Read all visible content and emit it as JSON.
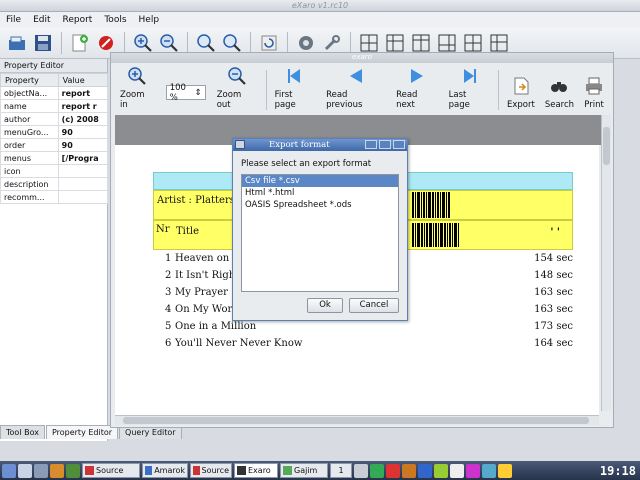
{
  "window": {
    "title": "eXaro v1.rc10"
  },
  "menu": [
    "File",
    "Edit",
    "Report",
    "Tools",
    "Help"
  ],
  "property_editor": {
    "title": "Property Editor",
    "columns": [
      "Property",
      "Value"
    ],
    "rows": [
      {
        "prop": "objectNa...",
        "value": "report"
      },
      {
        "prop": "name",
        "value": "report r"
      },
      {
        "prop": "author",
        "value": "(c) 2008"
      },
      {
        "prop": "menuGro...",
        "value": "90"
      },
      {
        "prop": "order",
        "value": "90"
      },
      {
        "prop": "menus",
        "value": "[/Progra"
      },
      {
        "prop": "icon",
        "value": ""
      },
      {
        "prop": "description",
        "value": ""
      },
      {
        "prop": "recomm...",
        "value": ""
      }
    ],
    "tabs": [
      "Tool Box",
      "Property Editor",
      "Query Editor"
    ]
  },
  "viewer": {
    "title": "exaro",
    "zoom_value": "100 %",
    "buttons": {
      "zoom_in": "Zoom in",
      "zoom_out": "Zoom out",
      "first_page": "First page",
      "read_previous": "Read previous",
      "read_next": "Read next",
      "last_page": "Last page",
      "export": "Export",
      "search": "Search",
      "print": "Print"
    }
  },
  "report": {
    "artist_label": "Artist : Platters",
    "header_nr": "Nr",
    "header_title": "Title",
    "header_dots": "' '",
    "songs": [
      {
        "n": "1",
        "title": "Heaven on E",
        "dur": "154 sec"
      },
      {
        "n": "2",
        "title": "It Isn't Righ",
        "dur": "148 sec"
      },
      {
        "n": "3",
        "title": "My Prayer",
        "dur": "163 sec"
      },
      {
        "n": "4",
        "title": "On My Word",
        "dur": "163 sec"
      },
      {
        "n": "5",
        "title": "One in a Million",
        "dur": "173 sec"
      },
      {
        "n": "6",
        "title": "You'll Never Never Know",
        "dur": "164 sec"
      }
    ]
  },
  "dialog": {
    "title": "Export format",
    "prompt": "Please select an export format",
    "options": [
      "Csv file *.csv",
      "Html *.html",
      "OASIS Spreadsheet *.ods"
    ],
    "selected_index": 0,
    "ok": "Ok",
    "cancel": "Cancel"
  },
  "taskbar": {
    "tasks": [
      "Source",
      "Amarok",
      "Source",
      "Exaro",
      "Gajim"
    ],
    "pager": "1",
    "clock": "19:18"
  },
  "colors": {
    "yellow_band": "#ffff66",
    "cyan_row": "#aeeaf5",
    "selection": "#5c87c7",
    "dialog_title": "#3e68a8"
  }
}
